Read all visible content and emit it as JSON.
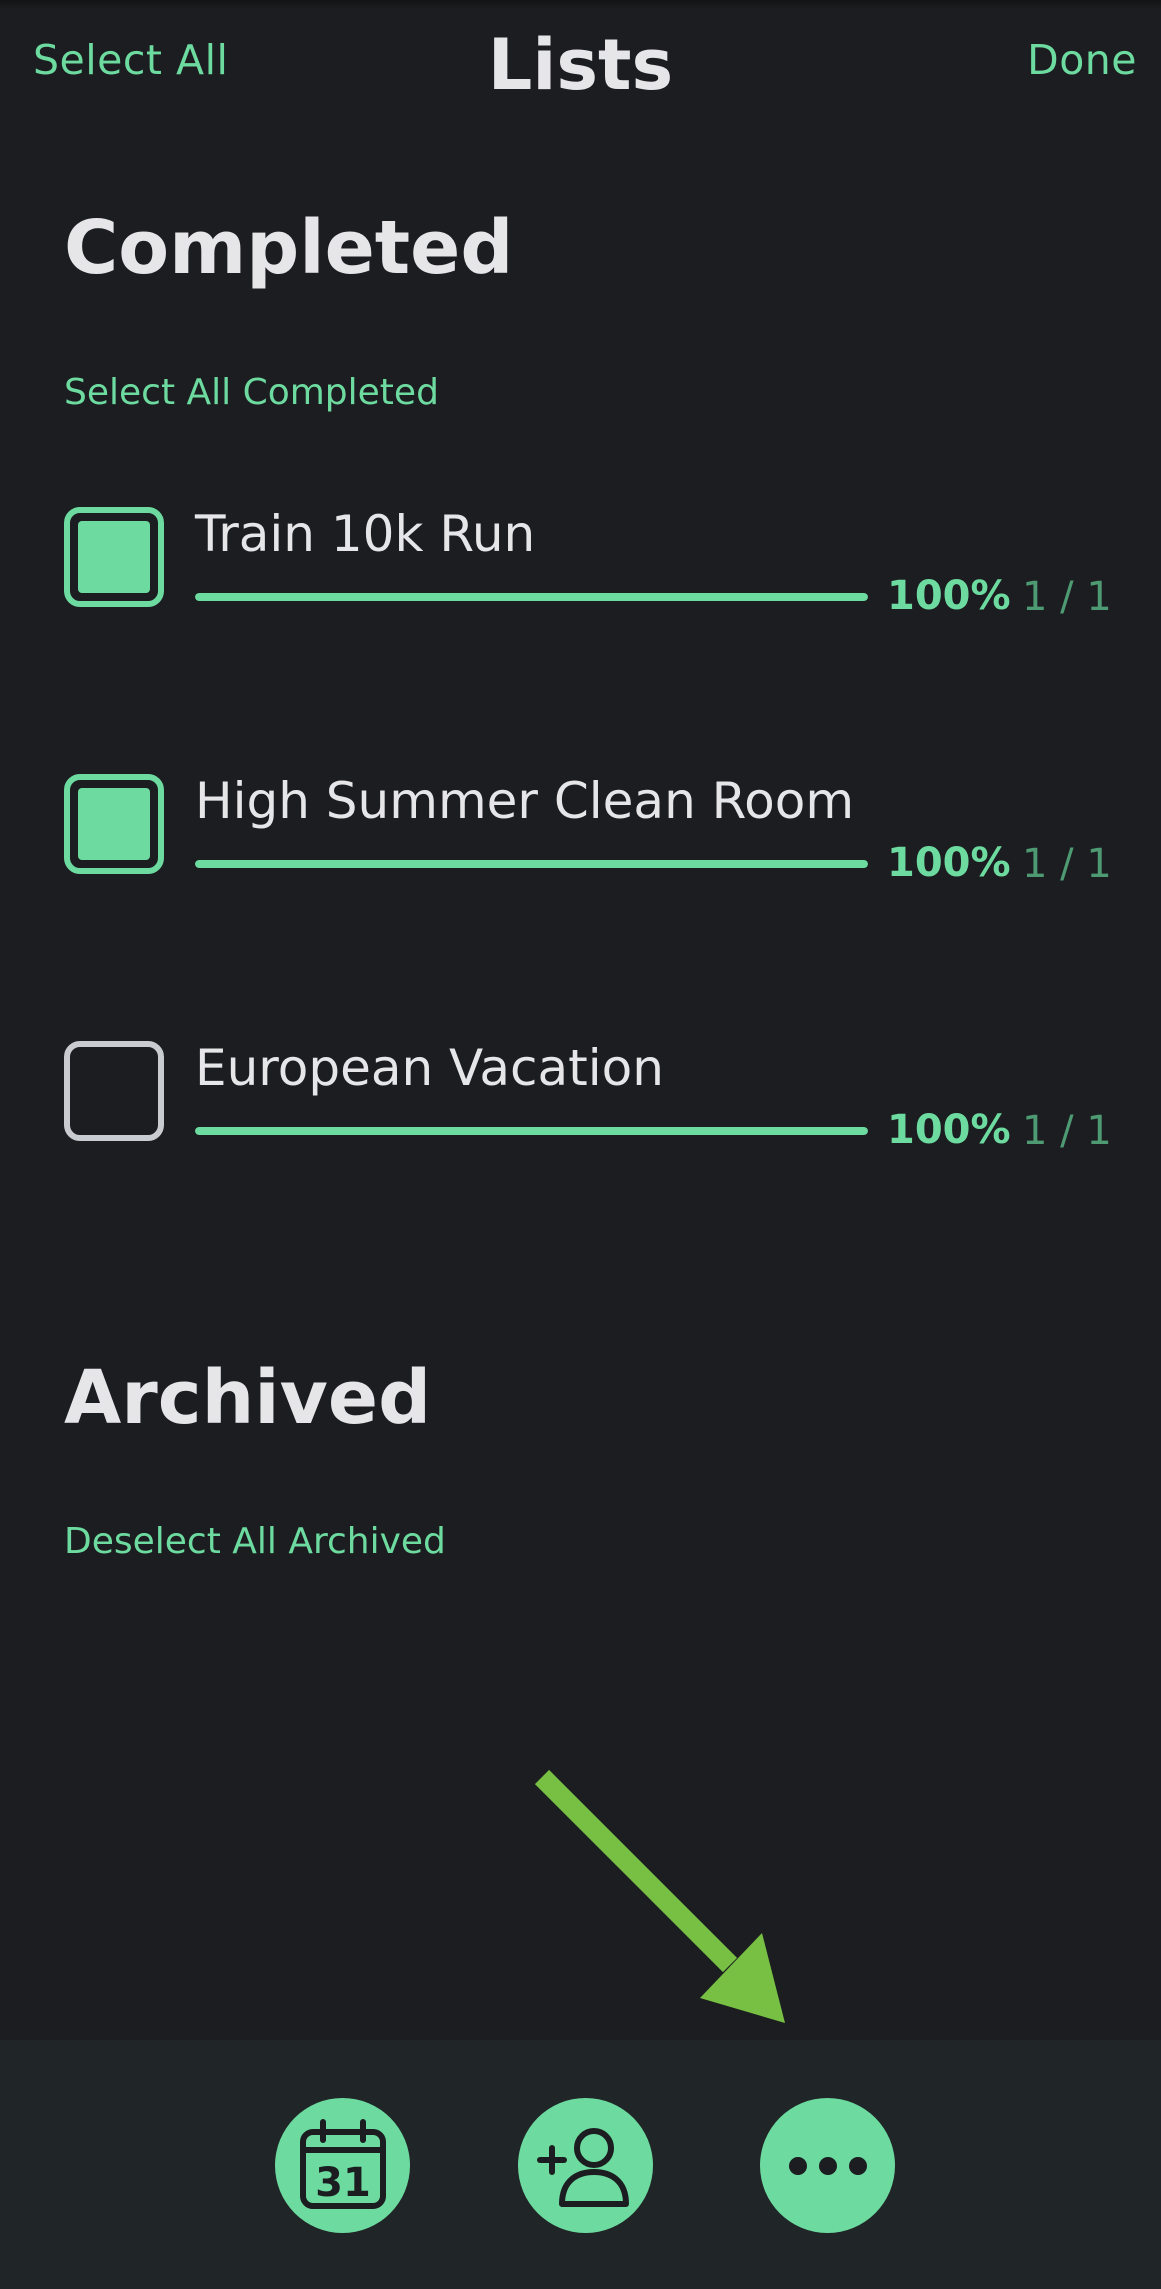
{
  "nav": {
    "select_all": "Select All",
    "title": "Lists",
    "done": "Done"
  },
  "sections": {
    "completed": {
      "title": "Completed",
      "action": "Select All Completed",
      "items": [
        {
          "title": "Train 10k Run",
          "checked": true,
          "progress": 1.0,
          "percent": "100%",
          "ratio": "1 / 1"
        },
        {
          "title": "High Summer Clean Room",
          "checked": true,
          "progress": 1.0,
          "percent": "100%",
          "ratio": "1 / 1"
        },
        {
          "title": "European Vacation",
          "checked": false,
          "progress": 1.0,
          "percent": "100%",
          "ratio": "1 / 1"
        }
      ]
    },
    "archived": {
      "title": "Archived",
      "action": "Deselect All Archived"
    }
  },
  "toolbar": {
    "calendar_day": "31",
    "icons": [
      "calendar-icon",
      "add-person-icon",
      "more-icon"
    ]
  },
  "colors": {
    "accent": "#6ddba0",
    "background": "#1b1d20",
    "annotation_arrow": "#77c043"
  }
}
